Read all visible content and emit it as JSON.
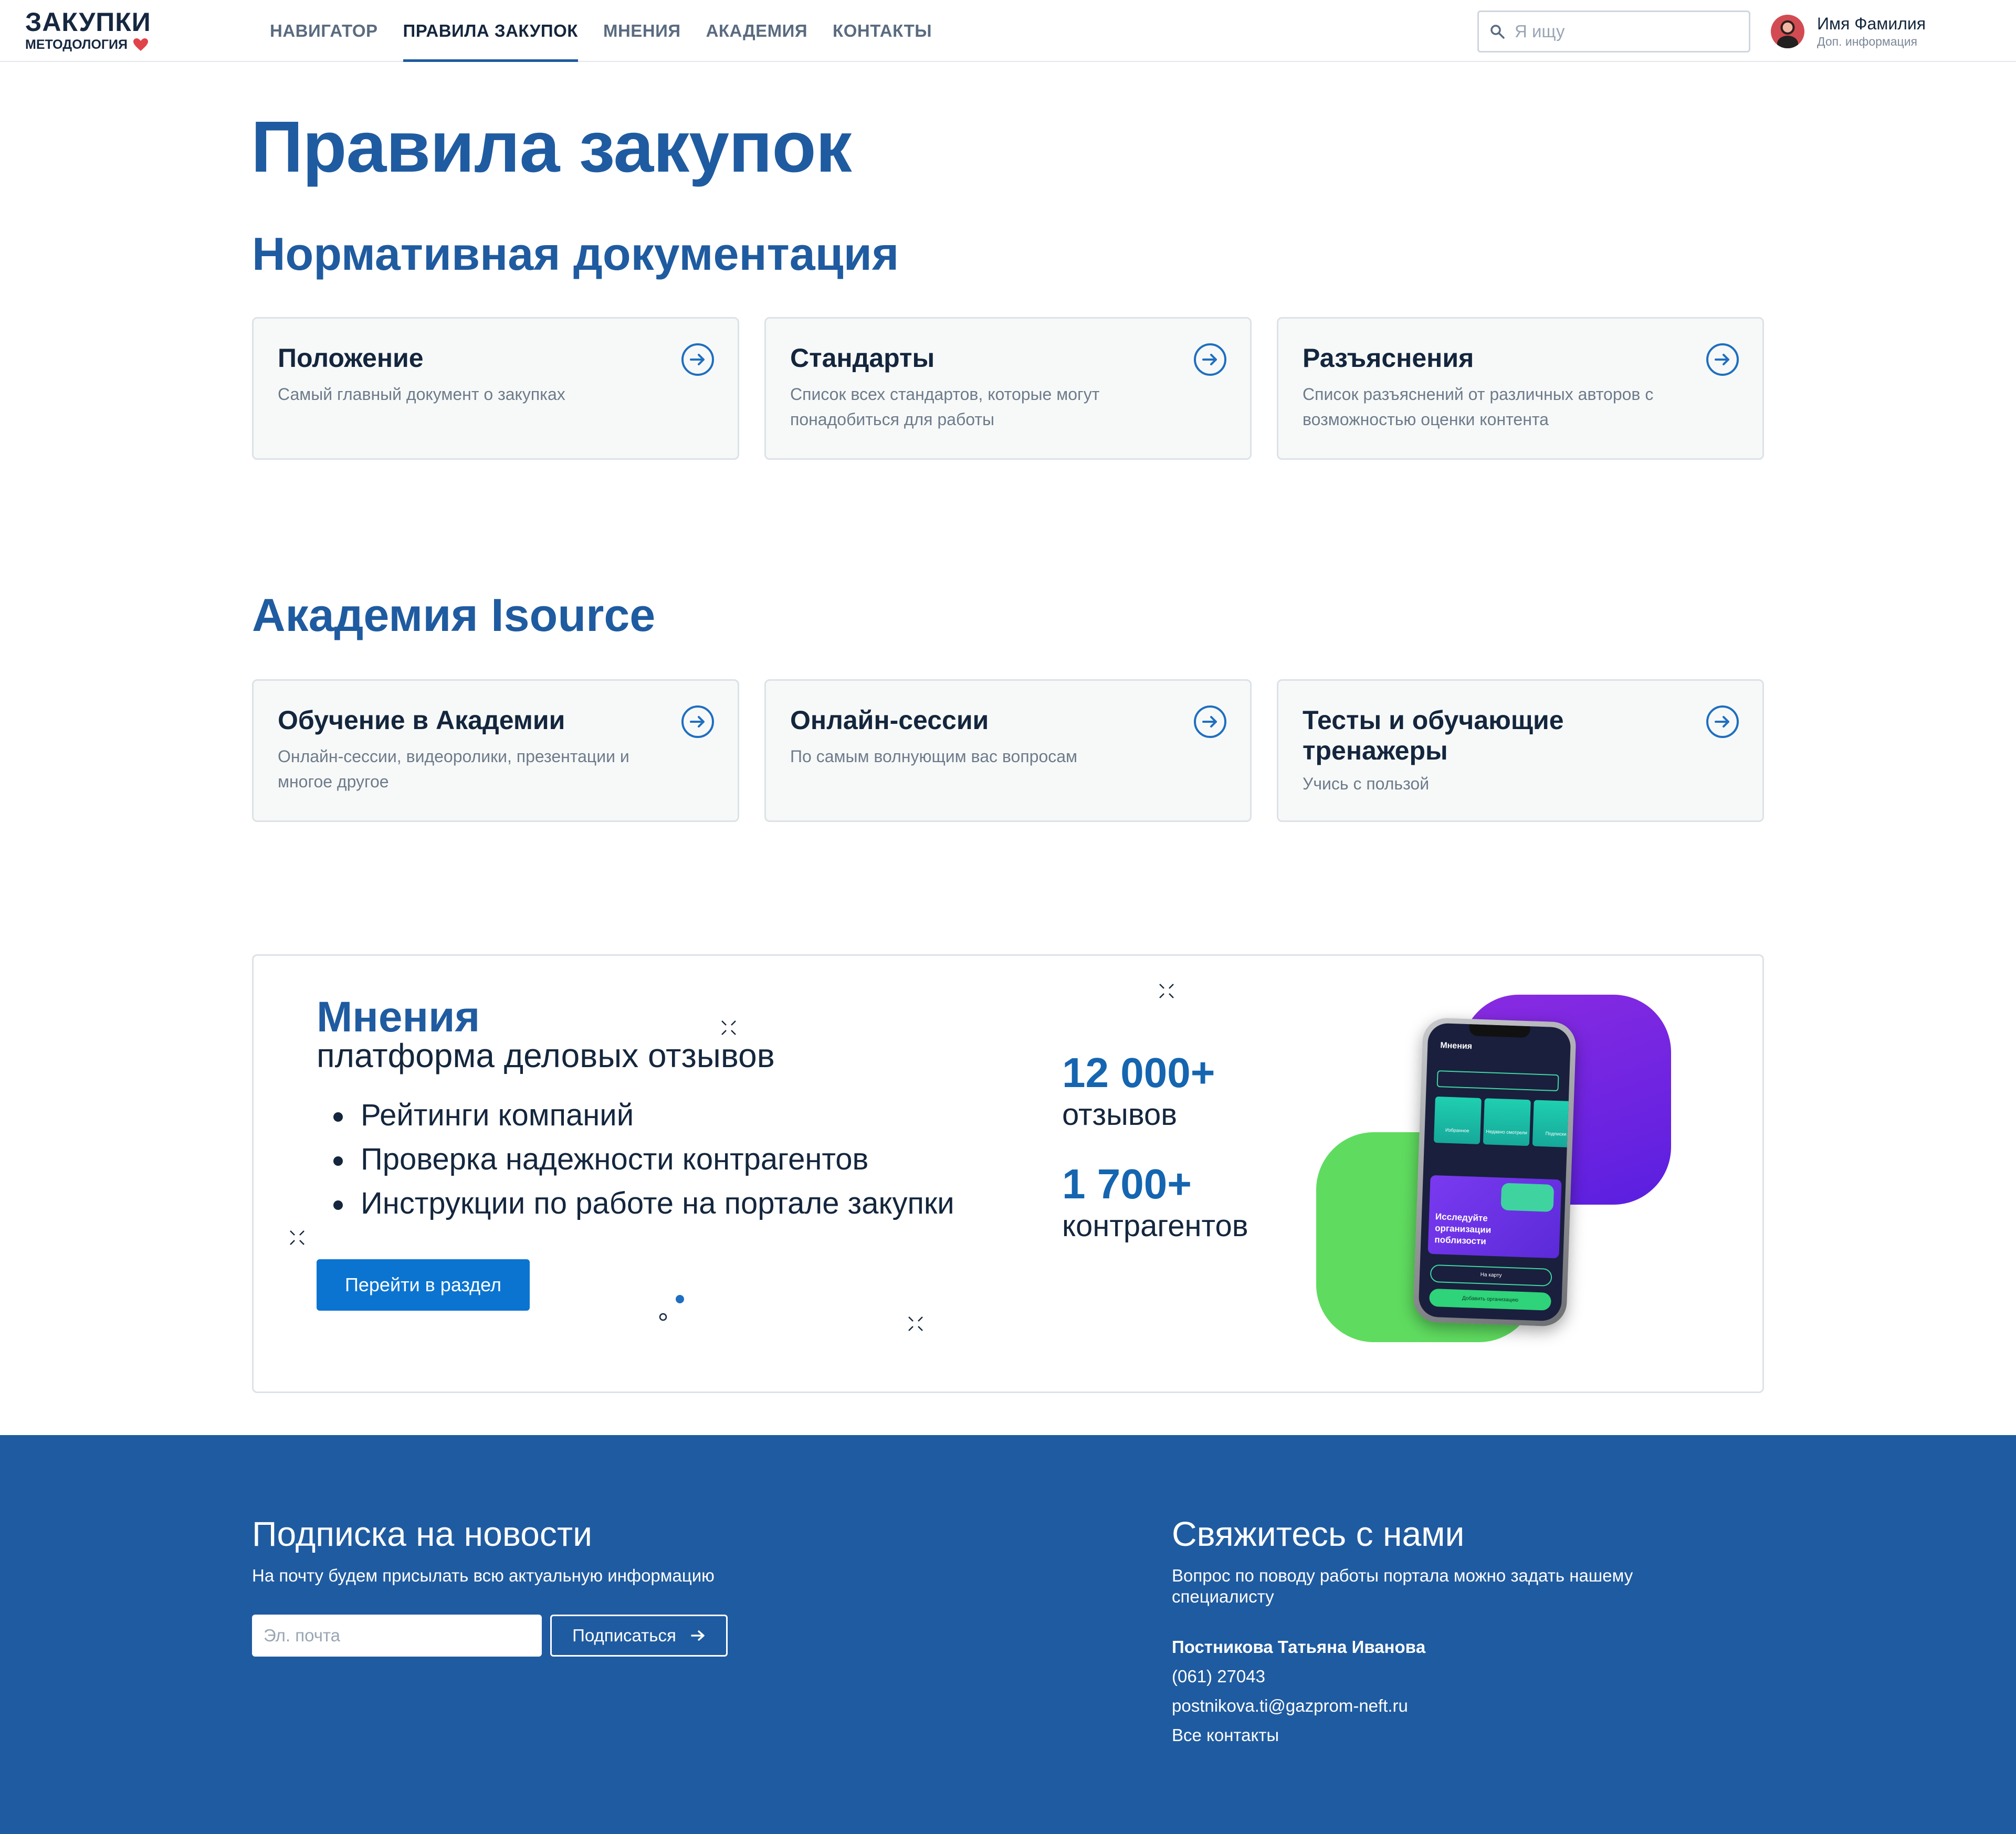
{
  "header": {
    "logo_title": "ЗАКУПКИ",
    "logo_sub": "МЕТОДОЛОГИЯ",
    "nav": [
      {
        "label": "НАВИГАТОР",
        "active": false
      },
      {
        "label": "ПРАВИЛА ЗАКУПОК",
        "active": true
      },
      {
        "label": "МНЕНИЯ",
        "active": false
      },
      {
        "label": "АКАДЕМИЯ",
        "active": false
      },
      {
        "label": "КОНТАКТЫ",
        "active": false
      }
    ],
    "search_placeholder": "Я ищу",
    "user_name": "Имя Фамилия",
    "user_info": "Доп. информация"
  },
  "page_title": "Правила закупок",
  "sections": [
    {
      "title": "Нормативная документация",
      "cards": [
        {
          "title": "Положение",
          "desc": "Самый главный документ о закупках"
        },
        {
          "title": "Стандарты",
          "desc": "Список всех стандартов, которые могут понадобиться для работы"
        },
        {
          "title": "Разъяснения",
          "desc": "Список разъяснений от различных авторов с возможностью оценки контента"
        }
      ]
    },
    {
      "title": "Академия Isource",
      "cards": [
        {
          "title": "Обучение в Академии",
          "desc": "Онлайн-сессии, видеоролики, презентации и многое другое"
        },
        {
          "title": "Онлайн-сессии",
          "desc": "По самым волнующим вас вопросам"
        },
        {
          "title": "Тесты и обучающие тренажеры",
          "desc": "Учись с пользой"
        }
      ]
    }
  ],
  "promo": {
    "title": "Мнения",
    "subtitle": "платформа деловых отзывов",
    "bullets": [
      "Рейтинги компаний",
      "Проверка надежности контрагентов",
      "Инструкции по работе на портале закупки"
    ],
    "button": "Перейти в раздел",
    "stats": [
      {
        "value": "12 000+",
        "label": "отзывов"
      },
      {
        "value": "1 700+",
        "label": "контрагентов"
      }
    ],
    "phone": {
      "brand": "Мнения",
      "banner": "Исследуйте организации поблизости",
      "map_btn": "На карту",
      "add_btn": "Добавить организацию",
      "tiles": [
        "Избранное",
        "Недавно смотрели",
        "Подписки"
      ]
    }
  },
  "footer": {
    "subscribe_title": "Подписка на новости",
    "subscribe_text": "На почту будем присылать всю актуальную информацию",
    "email_placeholder": "Эл. почта",
    "subscribe_button": "Подписаться",
    "contact_title": "Свяжитесь с нами",
    "contact_text": "Вопрос по поводу работы портала можно задать нашему специалисту",
    "contact_name": "Постникова Татьяна Ивановa",
    "contact_phone": "(061) 27043",
    "contact_email": "postnikova.ti@gazprom-neft.ru",
    "all_contacts": "Все контакты"
  },
  "colors": {
    "brand": "#1f5ba0",
    "accent_button": "#0b74d1",
    "stat": "#1565b0",
    "heart": "#e0434a"
  }
}
